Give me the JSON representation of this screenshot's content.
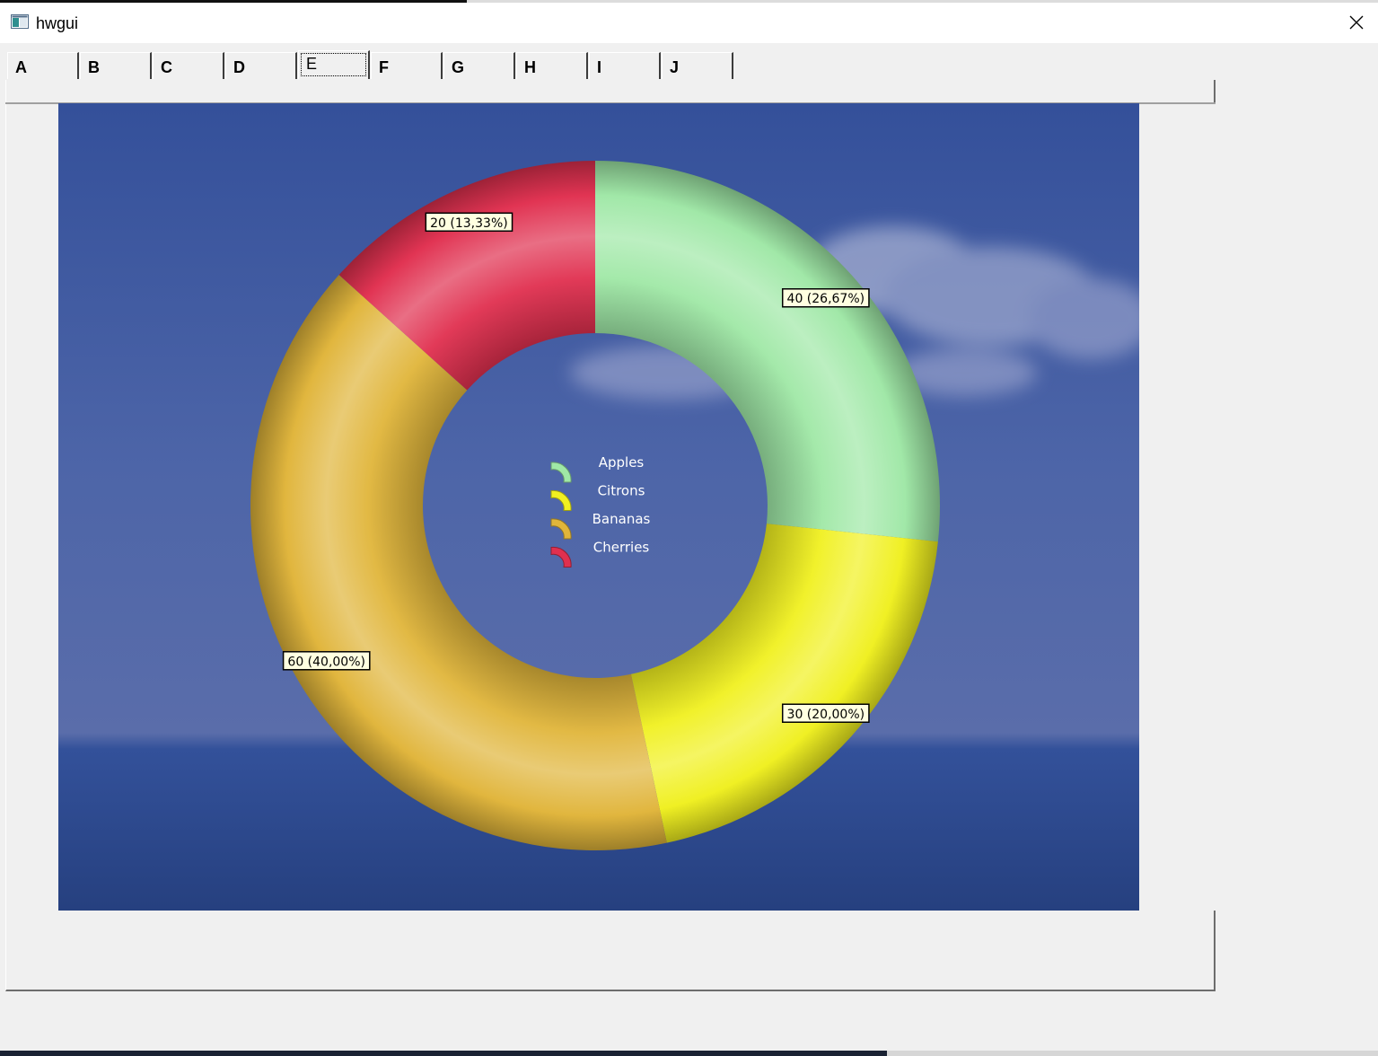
{
  "window": {
    "title": "hwgui",
    "icon": "app-window-icon",
    "close_icon": "close-icon"
  },
  "tabs": [
    {
      "label": "A"
    },
    {
      "label": "B"
    },
    {
      "label": "C"
    },
    {
      "label": "D"
    },
    {
      "label": "E"
    },
    {
      "label": "F"
    },
    {
      "label": "G"
    },
    {
      "label": "H"
    },
    {
      "label": "I"
    },
    {
      "label": "J"
    }
  ],
  "active_tab": "E",
  "chart_data": {
    "type": "pie",
    "variant": "donut",
    "title": "",
    "categories": [
      "Apples",
      "Citrons",
      "Bananas",
      "Cherries"
    ],
    "values": [
      40,
      30,
      60,
      20
    ],
    "labels": [
      "40 (26,67%)",
      "30 (20,00%)",
      "60 (40,00%)",
      "20 (13,33%)"
    ],
    "colors": [
      "#9fe8a6",
      "#f0f020",
      "#e0b53a",
      "#e0304f"
    ],
    "legend": {
      "placement": "center",
      "entries": [
        "Apples",
        "Citrons",
        "Bananas",
        "Cherries"
      ]
    },
    "start_angle": "12 o'clock",
    "direction": "clockwise",
    "background": "sky and sea photo"
  }
}
